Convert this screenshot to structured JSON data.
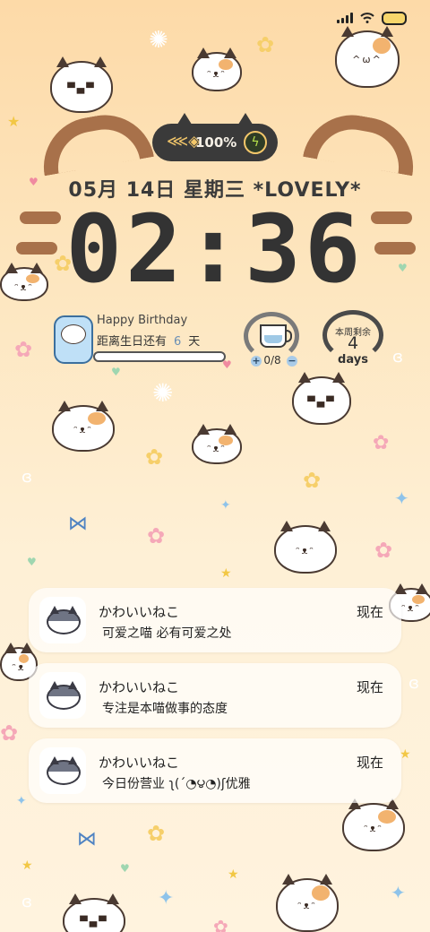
{
  "status_bar": {
    "signal_icon": "signal-icon",
    "wifi_icon": "wifi-icon",
    "battery_icon": "battery-icon"
  },
  "battery_pill": {
    "icon": "fish-icon",
    "percent": "100%",
    "charging_icon": "bolt-icon"
  },
  "date_line": "05月 14日  星期三  *LOVELY*",
  "clock": "02:36",
  "birthday_widget": {
    "title": "Happy Birthday",
    "prefix": "距离生日还有",
    "days": "6",
    "suffix": "天"
  },
  "water_widget": {
    "icon": "cup-icon",
    "count": "0/8",
    "minus": "+",
    "plus": "−"
  },
  "week_widget": {
    "label": "本周剩余",
    "number": "4",
    "unit": "days"
  },
  "notifications": [
    {
      "app": "かわいいねこ",
      "time": "现在",
      "message": "可爱之喵 必有可爱之处"
    },
    {
      "app": "かわいいねこ",
      "time": "现在",
      "message": "专注是本喵做事的态度"
    },
    {
      "app": "かわいいねこ",
      "time": "现在",
      "message": "今日份营业 ʅ(´◔౪◔)ʃ优雅"
    }
  ],
  "colors": {
    "background_top": "#fddaa8",
    "background_bottom": "#fff3de",
    "ink": "#333333",
    "accent_brown": "#a8714a"
  }
}
